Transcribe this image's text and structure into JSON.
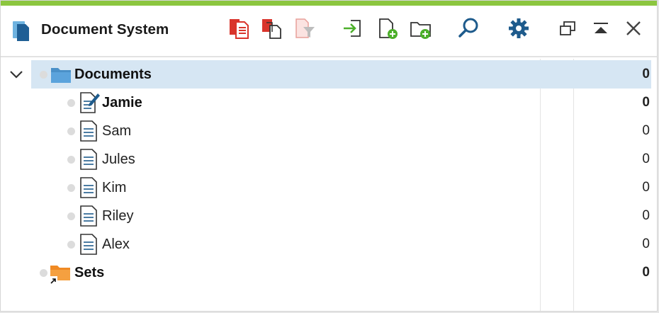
{
  "window": {
    "title": "Document System",
    "accent_color": "#8cc63f"
  },
  "toolbar": {
    "buttons": [
      {
        "name": "copy-activated-icon"
      },
      {
        "name": "duplicate-icon"
      },
      {
        "name": "filter-icon"
      },
      {
        "name": "import-icon"
      },
      {
        "name": "new-document-icon"
      },
      {
        "name": "new-folder-icon"
      },
      {
        "name": "search-icon"
      },
      {
        "name": "gear-icon"
      },
      {
        "name": "restore-window-icon"
      },
      {
        "name": "collapse-panel-icon"
      },
      {
        "name": "close-icon"
      }
    ]
  },
  "tree": {
    "root": {
      "label": "Documents",
      "count": "0",
      "expanded": true,
      "selected": true
    },
    "documents": [
      {
        "label": "Jamie",
        "count": "0",
        "bold": true,
        "icon": "edit-document-icon"
      },
      {
        "label": "Sam",
        "count": "0",
        "bold": false,
        "icon": "document-icon"
      },
      {
        "label": "Jules",
        "count": "0",
        "bold": false,
        "icon": "document-icon"
      },
      {
        "label": "Kim",
        "count": "0",
        "bold": false,
        "icon": "document-icon"
      },
      {
        "label": "Riley",
        "count": "0",
        "bold": false,
        "icon": "document-icon"
      },
      {
        "label": "Alex",
        "count": "0",
        "bold": false,
        "icon": "document-icon"
      }
    ],
    "sets": {
      "label": "Sets",
      "count": "0"
    }
  },
  "colors": {
    "selection": "#d6e6f3",
    "folder_blue": "#4a90c8",
    "folder_orange": "#f5a040",
    "red_icon": "#d9342b",
    "green_icon": "#4caf2a",
    "blue_icon": "#1e5b8c"
  }
}
